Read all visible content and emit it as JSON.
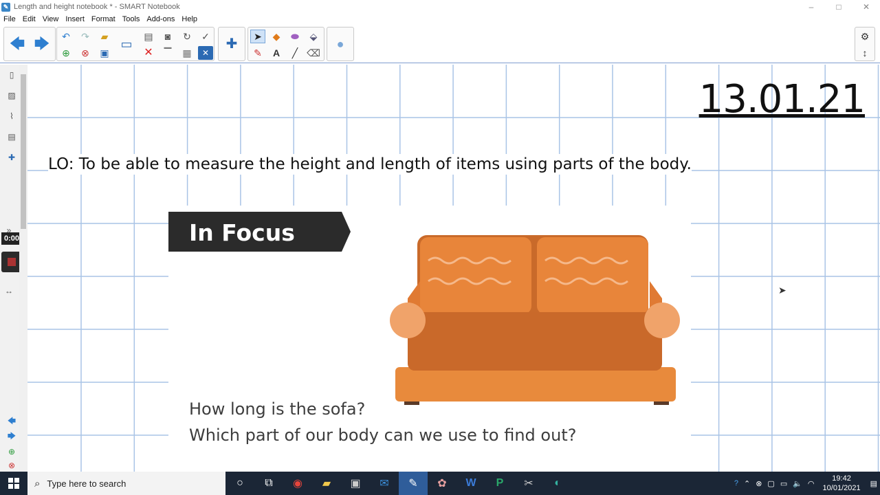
{
  "window": {
    "title": "Length and height notebook * - SMART Notebook",
    "minimize": "–",
    "maximize": "□",
    "close": "✕"
  },
  "menu": [
    "File",
    "Edit",
    "View",
    "Insert",
    "Format",
    "Tools",
    "Add-ons",
    "Help"
  ],
  "toolbar": {
    "icons": [
      "back-arrow-icon",
      "forward-arrow-icon",
      "undo-icon",
      "redo-icon",
      "open-folder-icon",
      "add-page-icon",
      "delete-page-icon",
      "save-icon",
      "display-icon",
      "paste-icon",
      "screen-capture-icon",
      "rotate-icon",
      "spell-check-icon",
      "delete-icon",
      "screen-shade-icon",
      "table-icon",
      "close-box-icon",
      "add-on-puzzle-icon",
      "select-arrow-icon",
      "shapes-icon",
      "eraser-pen-icon",
      "fill-icon",
      "pens-icon",
      "text-icon",
      "line-icon",
      "eraser-icon",
      "properties-icon",
      "settings-gear-icon",
      "move-toolbar-icon"
    ]
  },
  "side": {
    "timer": "0:00"
  },
  "page": {
    "date": "13.01.21",
    "lo": "LO: To be able to measure the height and length of items using parts of the body.",
    "focus": "In Focus",
    "question1": "How long is the sofa?",
    "question2": "Which part of our body can we use to find out?"
  },
  "taskbar": {
    "search_placeholder": "Type here to search",
    "time": "19:42",
    "date": "10/01/2021",
    "apps": [
      "cortana-icon",
      "task-view-icon",
      "chrome-icon",
      "file-explorer-icon",
      "store-icon",
      "mail-icon",
      "smart-notebook-icon",
      "paint-icon",
      "word-icon",
      "publisher-icon",
      "snipping-icon",
      "edge-icon"
    ]
  },
  "colors": {
    "grid": "#a9c4e6",
    "sofa": "#e88a3c",
    "sofa_dark": "#c9692a",
    "focus_bg": "#2b2b2b",
    "taskbar": "#1b2636"
  }
}
